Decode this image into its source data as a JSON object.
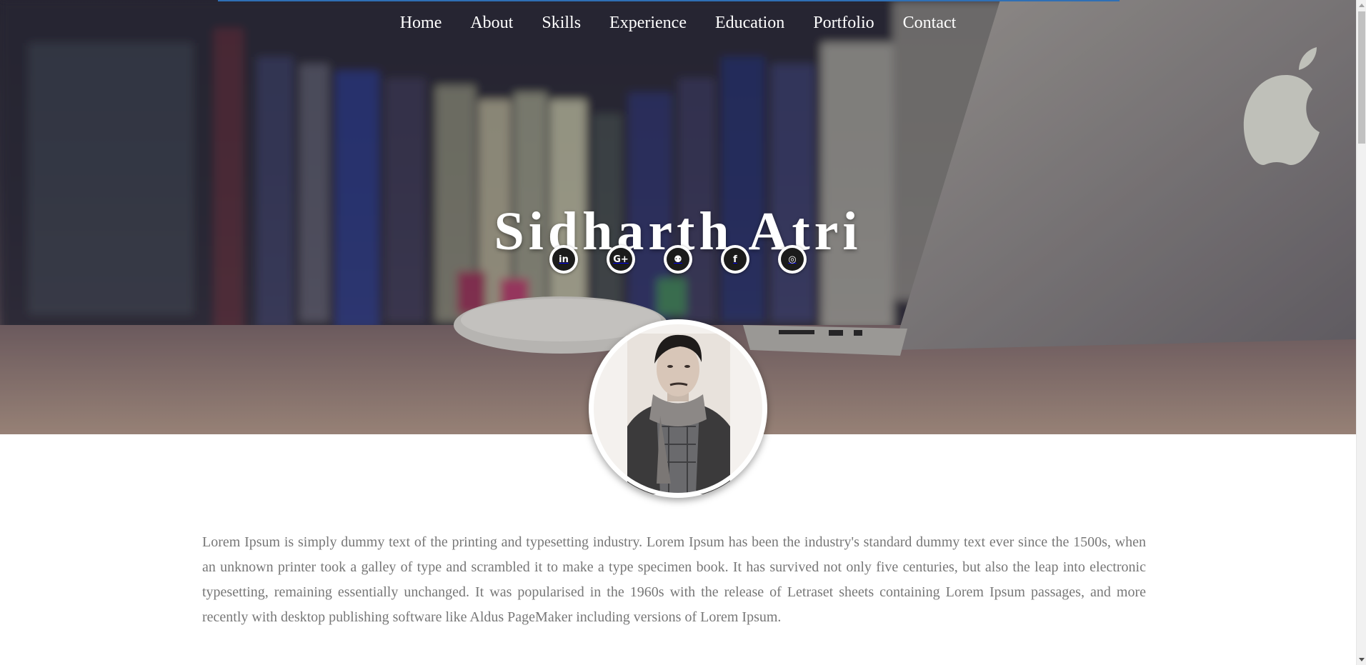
{
  "nav": {
    "items": [
      {
        "label": "Home"
      },
      {
        "label": "About"
      },
      {
        "label": "Skills"
      },
      {
        "label": "Experience"
      },
      {
        "label": "Education"
      },
      {
        "label": "Portfolio"
      },
      {
        "label": "Contact"
      }
    ]
  },
  "hero": {
    "name": "Sidharth Atri",
    "social": [
      {
        "icon": "linkedin-icon",
        "glyph": "in"
      },
      {
        "icon": "google-plus-icon",
        "glyph": "G+"
      },
      {
        "icon": "github-icon",
        "glyph": "⚉"
      },
      {
        "icon": "facebook-icon",
        "glyph": "f"
      },
      {
        "icon": "instagram-icon",
        "glyph": "◎"
      }
    ]
  },
  "about": {
    "text": "Lorem Ipsum is simply dummy text of the printing and typesetting industry. Lorem Ipsum has been the industry's standard dummy text ever since the 1500s, when an unknown printer took a galley of type and scrambled it to make a type specimen book. It has survived not only five centuries, but also the leap into electronic typesetting, remaining essentially unchanged. It was popularised in the 1960s with the release of Letraset sheets containing Lorem Ipsum passages, and more recently with desktop publishing software like Aldus PageMaker including versions of Lorem Ipsum."
  },
  "colors": {
    "accent_line": "#2f6fb5",
    "body_text": "#777777"
  }
}
